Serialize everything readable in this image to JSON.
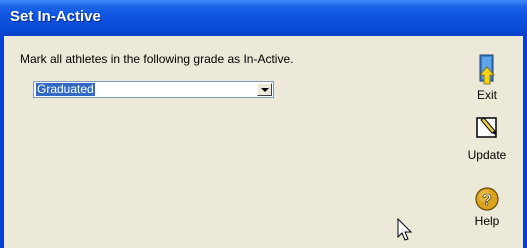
{
  "window": {
    "title": "Set In-Active"
  },
  "dialog": {
    "prompt": "Mark all athletes in the following grade as In-Active.",
    "grade_select": {
      "selected": "Graduated"
    }
  },
  "toolbar": {
    "exit_label": "Exit",
    "update_label": "Update",
    "help_label": "Help"
  },
  "icons": {
    "exit": "exit-door-icon",
    "update": "pencil-note-icon",
    "help": "help-question-icon",
    "cursor": "mouse-pointer-icon"
  },
  "colors": {
    "titlebar": "#0c51de",
    "client_bg": "#ece9d8",
    "selection": "#316ac5"
  }
}
